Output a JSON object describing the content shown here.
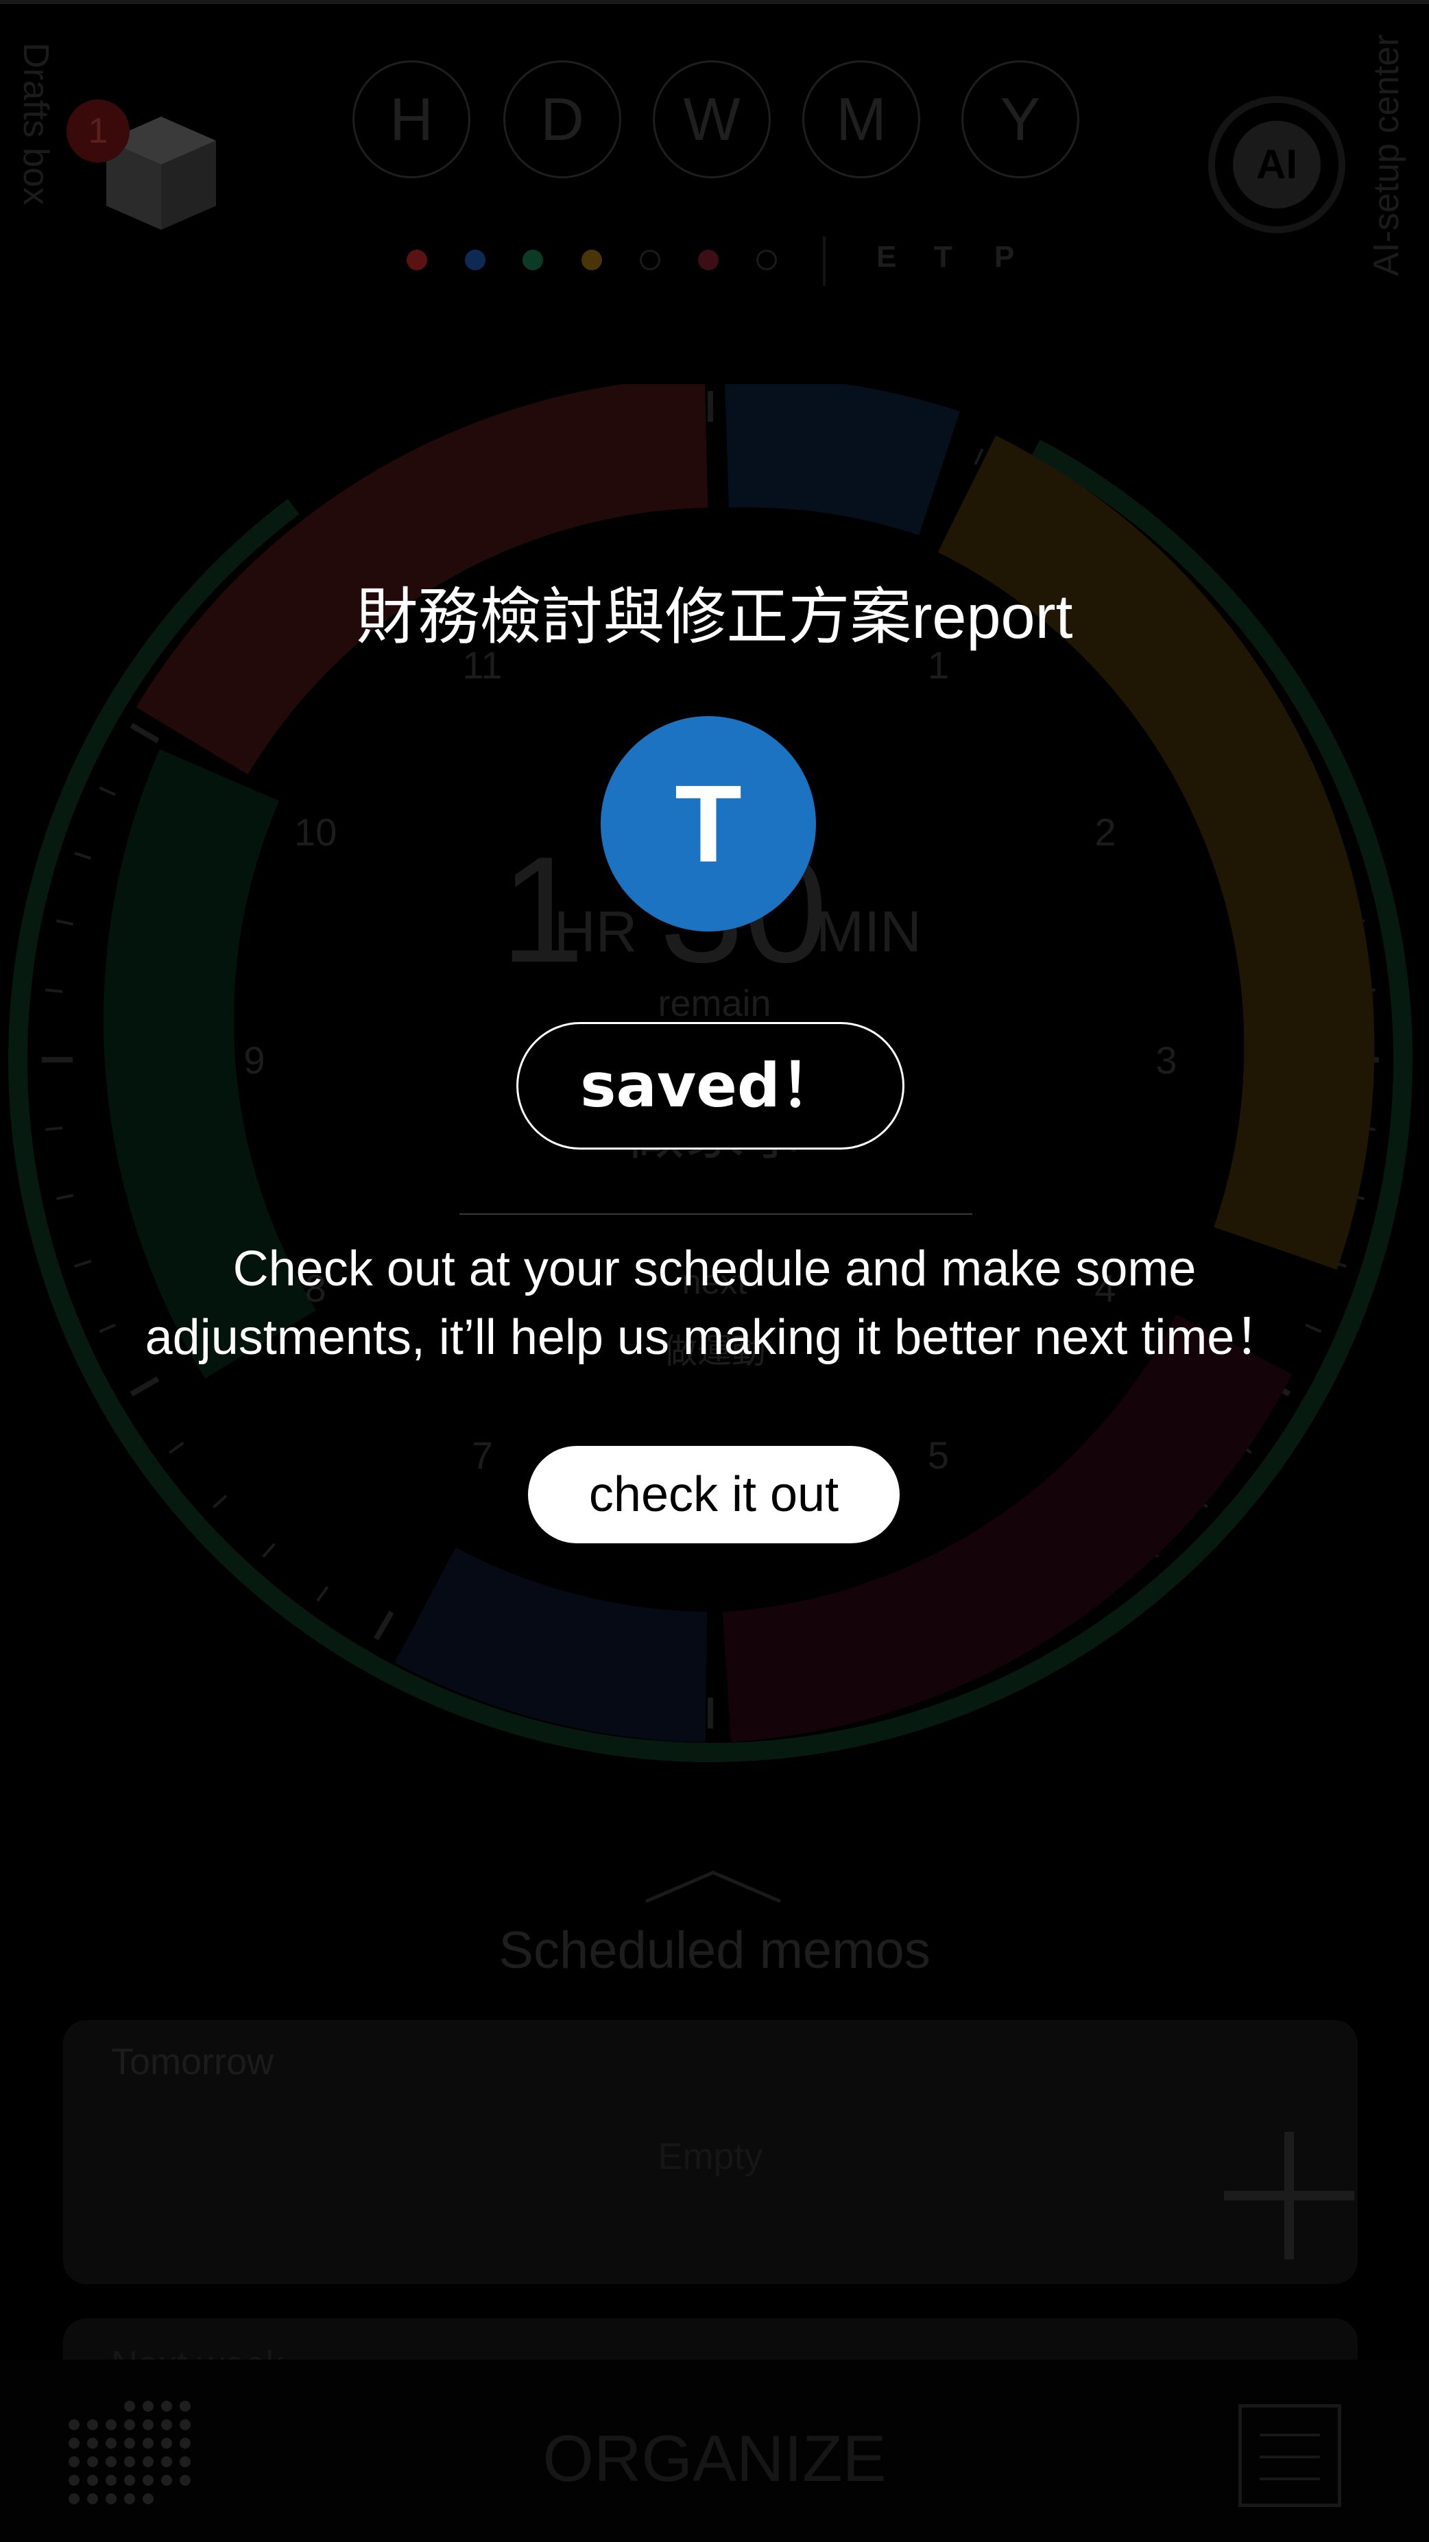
{
  "app": {
    "drafts_label": "Drafts box",
    "drafts_badge": "1",
    "ai_label": "AI-setup center",
    "ai_button_label": "AI",
    "period_tabs": [
      "H",
      "D",
      "W",
      "M",
      "Y"
    ],
    "category_dot_colors": [
      "#5a1212",
      "#0d2a55",
      "#0c3b25",
      "#4a3508",
      "#111111",
      "#3c0e16",
      "#111111"
    ],
    "filter_letters": [
      "E",
      "T",
      "P"
    ],
    "clock": {
      "hours": "1",
      "hours_unit": "HR",
      "minutes": "30",
      "minutes_unit": "MIN",
      "remain_label": "remain",
      "task": "做家事",
      "sub_label_1": "next",
      "sub_label_2": "做運動",
      "hour_numbers": [
        "11",
        "1",
        "10",
        "2",
        "9",
        "3",
        "8",
        "4",
        "7",
        "5"
      ]
    },
    "memos_title": "Scheduled memos",
    "memo_day": "Tomorrow",
    "memo_empty": "Empty",
    "memo_day_2": "Next week",
    "organize_title": "ORGANIZE"
  },
  "modal": {
    "title_cjk": "財務檢討與修正方案",
    "title_latin": "report",
    "avatar_letter": "T",
    "saved_label": "saved！",
    "message_line1": "Check out at your schedule and make some",
    "message_line2": "adjustments, it’ll help us making it better next time！",
    "button_label": "check it out"
  },
  "colors": {
    "avatar": "#1c73c2",
    "overlay": "#000000"
  }
}
